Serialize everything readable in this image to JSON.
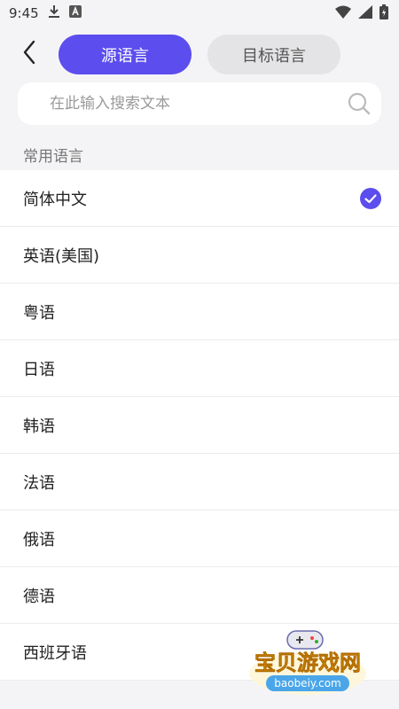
{
  "status_bar": {
    "time": "9:45"
  },
  "header": {
    "tabs": [
      {
        "label": "源语言",
        "active": true
      },
      {
        "label": "目标语言",
        "active": false
      }
    ]
  },
  "search": {
    "placeholder": "在此输入搜索文本"
  },
  "section": {
    "title": "常用语言"
  },
  "languages": [
    {
      "label": "简体中文",
      "selected": true
    },
    {
      "label": "英语(美国)"
    },
    {
      "label": "粤语"
    },
    {
      "label": "日语"
    },
    {
      "label": "韩语"
    },
    {
      "label": "法语"
    },
    {
      "label": "俄语"
    },
    {
      "label": "德语"
    },
    {
      "label": "西班牙语"
    }
  ],
  "watermark": {
    "text": "宝贝游戏网",
    "domain": "baobeiy.com"
  },
  "colors": {
    "accent": "#5b4dee",
    "inactive_tab": "#e4e4e6",
    "background": "#f4f4f6"
  }
}
